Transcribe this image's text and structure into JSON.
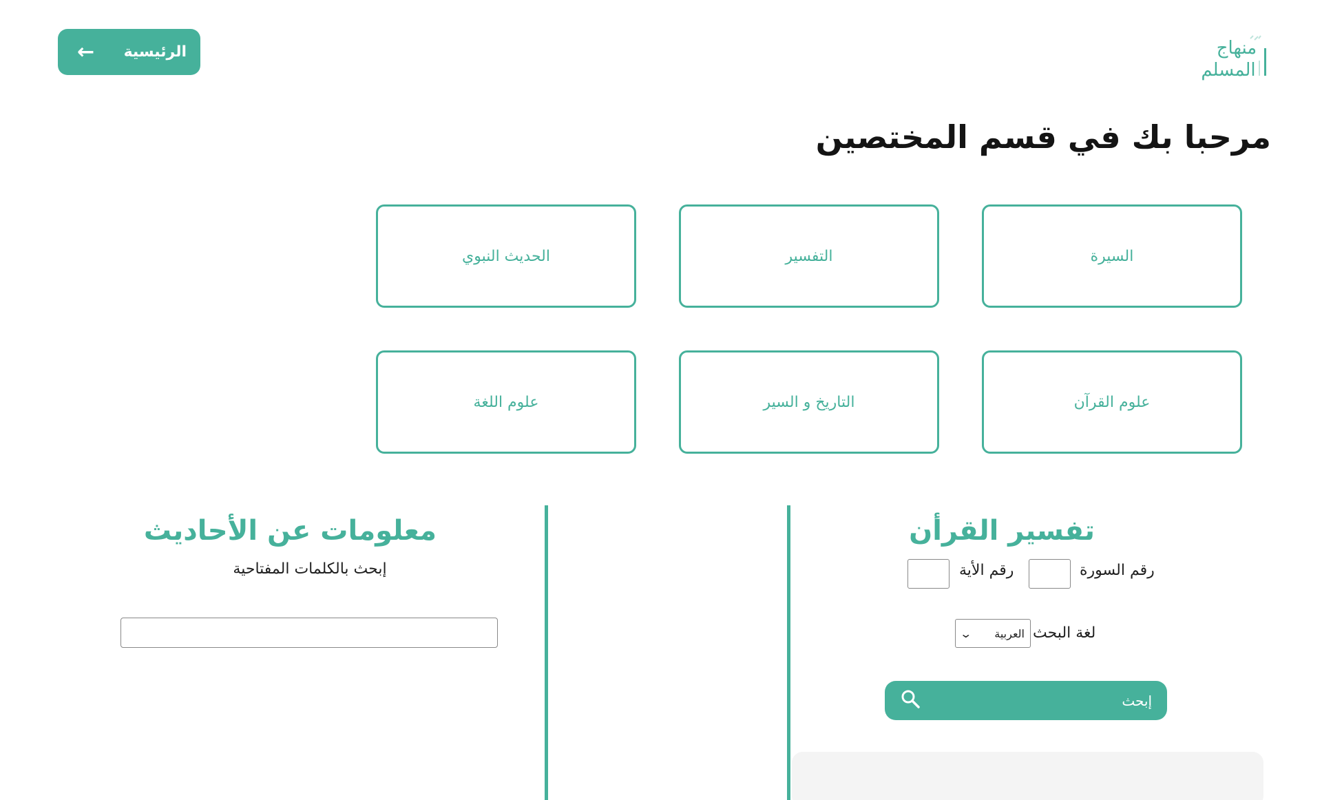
{
  "header": {
    "logo_line1": "منهاج",
    "logo_line2": "المسلم",
    "home_label": "الرئيسية",
    "home_icon": "arrow-left-icon",
    "accent_color": "#46b19b"
  },
  "page_title": "مرحبا بك في قسم المختصين",
  "categories": [
    {
      "label": "السيرة"
    },
    {
      "label": "التفسير"
    },
    {
      "label": "الحديث النبوي"
    },
    {
      "label": "علوم القرآن"
    },
    {
      "label": "التاريخ و السير"
    },
    {
      "label": "علوم اللغة"
    }
  ],
  "tafsir": {
    "title": "تفسير القرأن",
    "surah_label": "رقم السورة",
    "surah_value": "",
    "ayah_label": "رقم الأية",
    "ayah_value": "",
    "lang_label": "لغة البحث",
    "lang_selected": "العربية",
    "search_label": "إبحث",
    "search_icon": "search-icon"
  },
  "hadith": {
    "title": "معلومات عن الأحاديث",
    "subtitle": "إبحث بالكلمات المفتاحية",
    "keyword_value": ""
  }
}
